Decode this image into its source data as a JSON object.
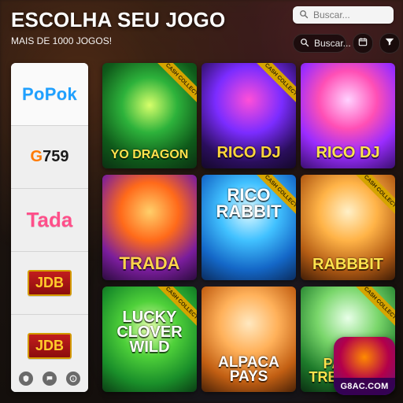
{
  "header": {
    "title": "ESCOLHA SEU JOGO",
    "subtitle": "MAIS DE 1000 JOGOS!"
  },
  "search_top": {
    "placeholder": "Buscar..."
  },
  "toolbar": {
    "search_label": "Buscar..."
  },
  "sidebar": {
    "providers": [
      {
        "label": "PoPok"
      },
      {
        "label": "G759"
      },
      {
        "label": "Tada"
      },
      {
        "label": "JDB"
      },
      {
        "label": "JDB"
      }
    ]
  },
  "games": [
    {
      "name": "YO DRAGON",
      "ribbon": "CASH COLLECT"
    },
    {
      "name": "RICO DJ",
      "ribbon": "CASH COLLECT"
    },
    {
      "name": "RICO DJ",
      "ribbon": ""
    },
    {
      "name": "TRADA",
      "ribbon": ""
    },
    {
      "name": "RICO RABBIT",
      "ribbon": "CASH COLLECT"
    },
    {
      "name": "RABBBIT",
      "ribbon": "CASH COLLECT"
    },
    {
      "name": "LUCKY CLOVER WILD",
      "ribbon": "CASH COLLECT"
    },
    {
      "name": "ALPACA PAYS",
      "ribbon": ""
    },
    {
      "name": "PANDA TREASURE",
      "ribbon": "CASH COLLECT"
    }
  ],
  "fab": {
    "label": "G8AC.COM"
  },
  "colors": {
    "accent_blue": "#1fa0ff",
    "ribbon_gold": "#d5a400"
  }
}
